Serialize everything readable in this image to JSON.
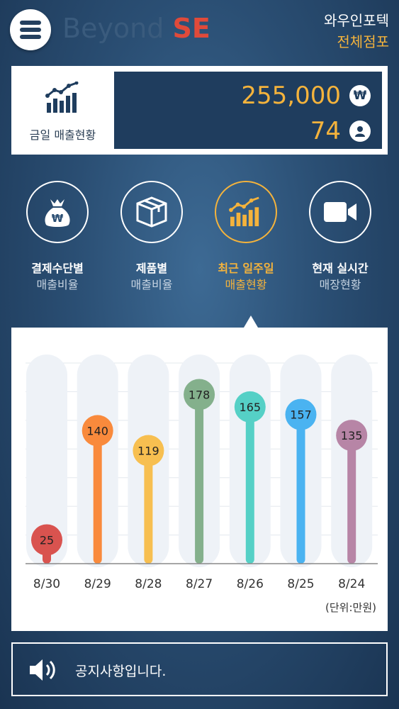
{
  "header": {
    "logo_primary": "Beyond",
    "logo_accent": "SE",
    "company_name": "와우인포텍",
    "branch": "전체점포"
  },
  "summary": {
    "label": "금일 매출현황",
    "sales_amount": "255,000",
    "sales_icon": "won-icon",
    "customer_count": "74",
    "customer_icon": "person-icon"
  },
  "categories": [
    {
      "line1": "결제수단별",
      "line2": "매출비율",
      "icon": "money-bag-icon"
    },
    {
      "line1": "제품별",
      "line2": "매출비율",
      "icon": "box-icon"
    },
    {
      "line1": "최근 일주일",
      "line2": "매출현황",
      "icon": "chart-icon",
      "active": true
    },
    {
      "line1": "현재 실시간",
      "line2": "매장현황",
      "icon": "video-camera-icon"
    }
  ],
  "chart_data": {
    "type": "bar",
    "categories": [
      "8/30",
      "8/29",
      "8/28",
      "8/27",
      "8/26",
      "8/25",
      "8/24"
    ],
    "values": [
      25,
      140,
      119,
      178,
      165,
      157,
      135
    ],
    "colors": [
      "#d9534f",
      "#f98a3c",
      "#f7bf50",
      "#84b08c",
      "#55d0c6",
      "#4ab3f1",
      "#b785a6"
    ],
    "ylim": [
      0,
      200
    ],
    "unit_label": "(단위:만원)"
  },
  "notice": {
    "text": "공지사항입니다."
  },
  "colors": {
    "accent": "#f4b33c",
    "navy": "#1f3d5e"
  }
}
